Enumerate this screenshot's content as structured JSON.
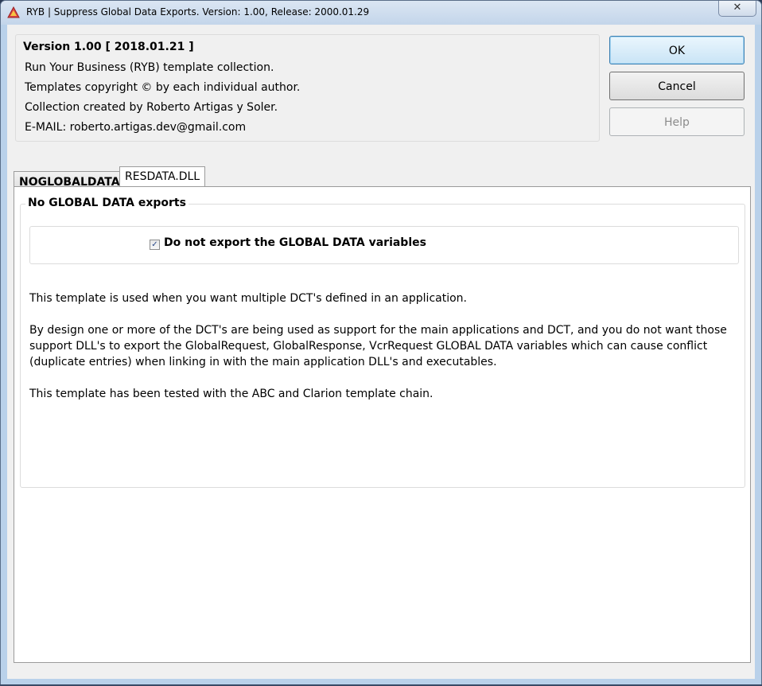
{
  "window": {
    "title": "RYB | Suppress Global Data Exports. Version: 1.00, Release: 2000.01.29",
    "close_label": "✕"
  },
  "info": {
    "version": "Version 1.00 [ 2018.01.21 ]",
    "line1": "Run Your Business (RYB) template collection.",
    "line2": "Templates copyright © by each individual author.",
    "line3": "Collection created by Roberto Artigas y Soler.",
    "line4": "E-MAIL: roberto.artigas.dev@gmail.com"
  },
  "buttons": {
    "ok": "OK",
    "cancel": "Cancel",
    "help": "Help"
  },
  "tabs": [
    {
      "label": "NOGLOBALDATA",
      "active": false
    },
    {
      "label": "RESDATA.DLL",
      "active": true
    }
  ],
  "panel": {
    "group_title": "No GLOBAL DATA exports",
    "checkbox_label": "Do not export the GLOBAL DATA variables",
    "checkbox_checked": true,
    "para1": "This template is used when you want multiple DCT's defined in an application.",
    "para2_l1": "By design one or more of the DCT's are being used as support for the main applications and DCT, and you do not want those",
    "para2_l2": "support DLL's to export the GlobalRequest, GlobalResponse, VcrRequest GLOBAL DATA variables which can cause conflict",
    "para2_l3": "(duplicate entries) when linking in with the main application DLL's and executables.",
    "para3": "This template has been tested with the ABC and Clarion template chain."
  }
}
